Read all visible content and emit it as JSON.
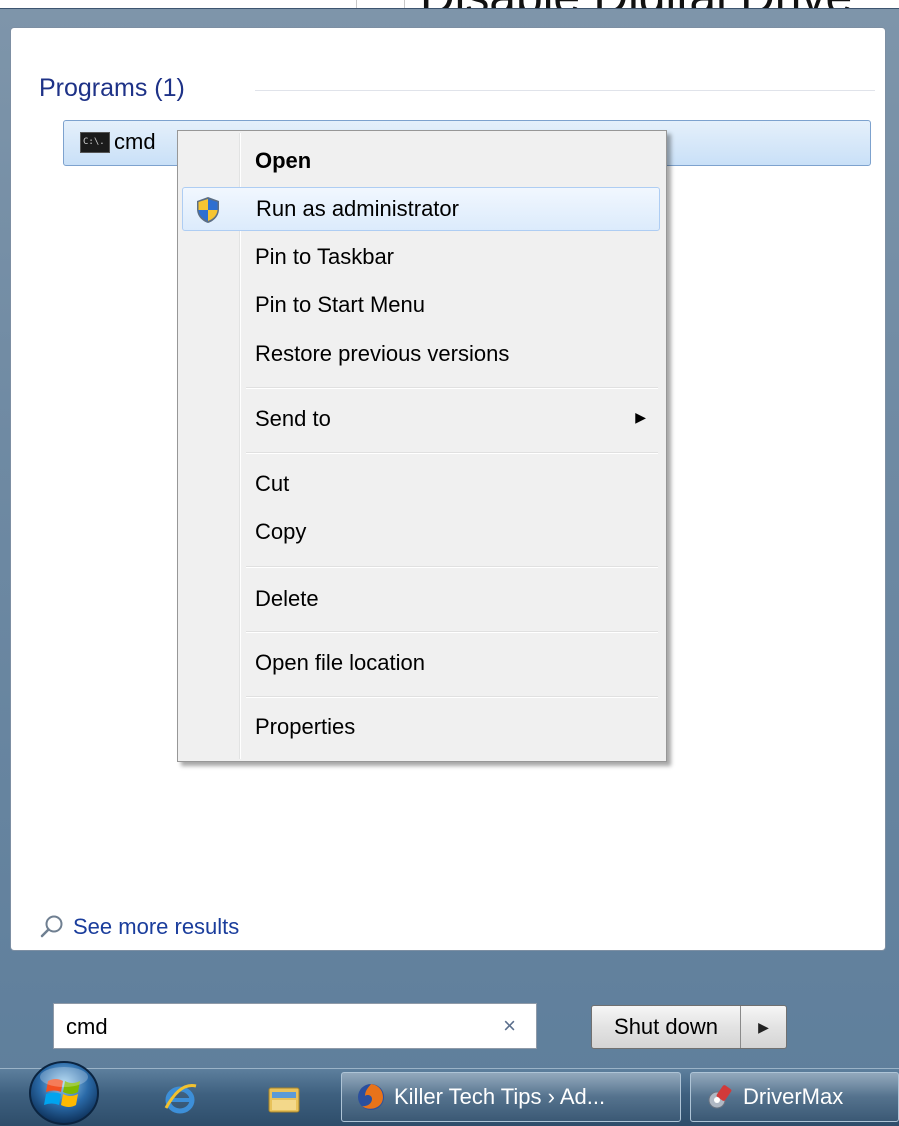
{
  "background": {
    "heading": "Disable Digital Drive"
  },
  "start_menu": {
    "section_header": "Programs (1)",
    "program": {
      "label": "cmd",
      "icon": "cmd-icon",
      "icon_text": "C:\\."
    },
    "see_more": "See more results",
    "search": {
      "value": "cmd",
      "clear_glyph": "×"
    },
    "shutdown": {
      "label": "Shut down",
      "arrow": "▶"
    }
  },
  "context_menu": {
    "items": [
      {
        "label": "Open",
        "bold": true
      },
      {
        "label": "Run as administrator",
        "icon": "uac-shield-icon",
        "hovered": true
      },
      {
        "label": "Pin to Taskbar"
      },
      {
        "label": "Pin to Start Menu"
      },
      {
        "label": "Restore previous versions"
      },
      {
        "label": "Send to",
        "submenu_arrow": "▶"
      },
      {
        "label": "Cut"
      },
      {
        "label": "Copy"
      },
      {
        "label": "Delete"
      },
      {
        "label": "Open file location"
      },
      {
        "label": "Properties"
      }
    ]
  },
  "taskbar": {
    "start_button": "windows-orb-icon",
    "pinned": [
      "internet-explorer-icon",
      "windows-explorer-icon"
    ],
    "tasks": [
      {
        "label": "Killer Tech Tips › Ad...",
        "icon": "firefox-icon"
      },
      {
        "label": "DriverMax",
        "icon": "drivermax-icon"
      }
    ]
  }
}
